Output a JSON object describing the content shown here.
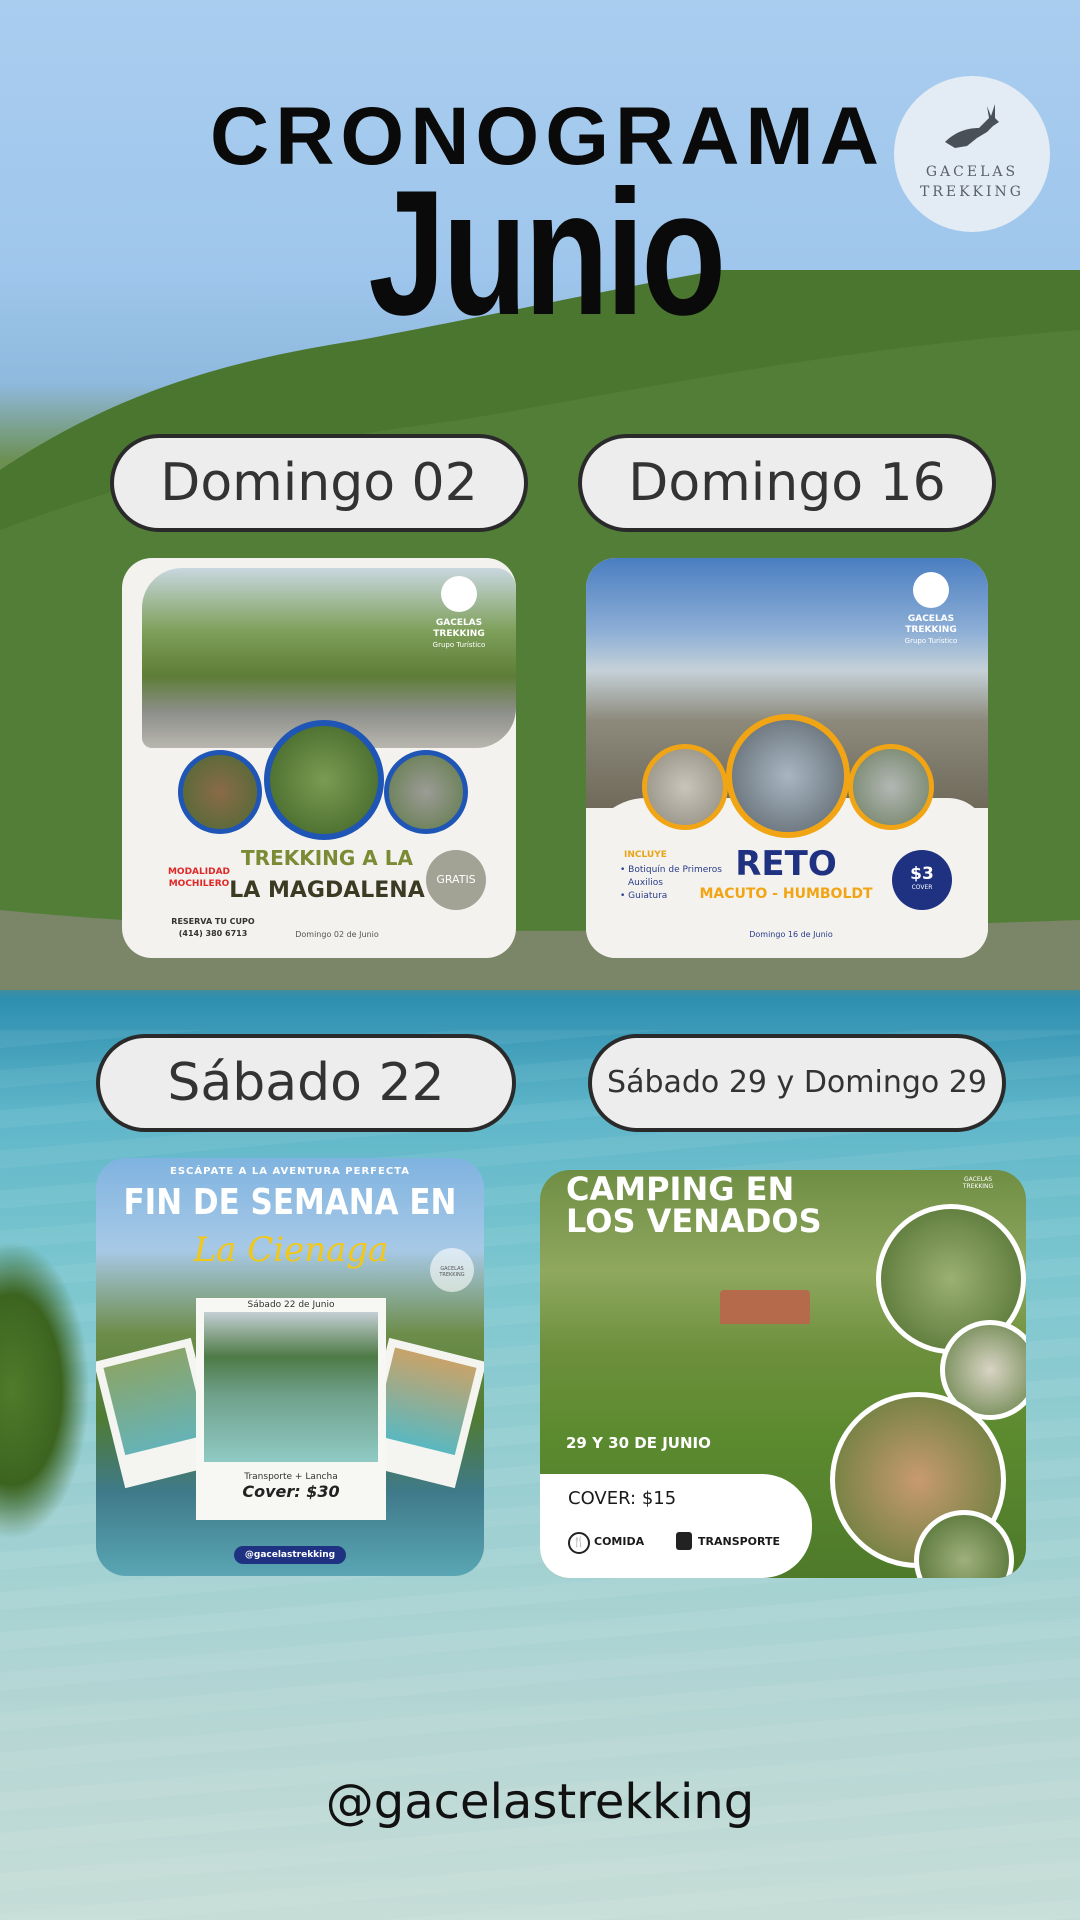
{
  "header": {
    "title_line1": "CRONOGRAMA",
    "title_line2": "Junio"
  },
  "logo": {
    "line1": "GACELAS",
    "line2": "TREKKING"
  },
  "dates": {
    "d1": "Domingo 02",
    "d2": "Domingo 16",
    "d3": "Sábado 22",
    "d4": "Sábado 29 y Domingo 29"
  },
  "card1": {
    "brand1": "GACELAS",
    "brand2": "TREKKING",
    "brand3": "Grupo Turístico",
    "modalidad1": "MODALIDAD",
    "modalidad2": "MOCHILERO",
    "title1": "TREKKING A LA",
    "title2": "LA MAGDALENA",
    "badge": "GRATIS",
    "reserva1": "RESERVA TU CUPO",
    "reserva2": "(414) 380 6713",
    "date": "Domingo 02 de Junio"
  },
  "card2": {
    "brand1": "GACELAS",
    "brand2": "TREKKING",
    "brand3": "Grupo Turístico",
    "incluye": "INCLUYE",
    "items": [
      "• Botiquín de Primeros",
      "Auxilios",
      "• Guiatura"
    ],
    "title1": "RETO",
    "title2": "MACUTO - HUMBOLDT",
    "price": "$3",
    "price_label": "COVER",
    "date": "Domingo 16 de Junio"
  },
  "card3": {
    "kicker": "ESCÁPATE A LA AVENTURA PERFECTA",
    "title": "FIN DE SEMANA EN",
    "script": "La Cienaga",
    "polaroid_date": "Sábado 22 de Junio",
    "transport": "Transporte + Lancha",
    "cover": "Cover: $30",
    "handle": "@gacelastrekking",
    "brand1": "GACELAS",
    "brand2": "TREKKING"
  },
  "card4": {
    "title1": "CAMPING EN",
    "title2": "LOS VENADOS",
    "dates": "29 Y 30 DE JUNIO",
    "cover": "COVER: $15",
    "comida": "COMIDA",
    "transporte": "TRANSPORTE",
    "brand": "GACELAS TREKKING"
  },
  "footer": {
    "handle": "@gacelastrekking"
  },
  "colors": {
    "blue_ring": "#1f55b5",
    "orange_ring": "#f2a514",
    "green_title": "#7b8b35",
    "navy": "#1f3282"
  }
}
